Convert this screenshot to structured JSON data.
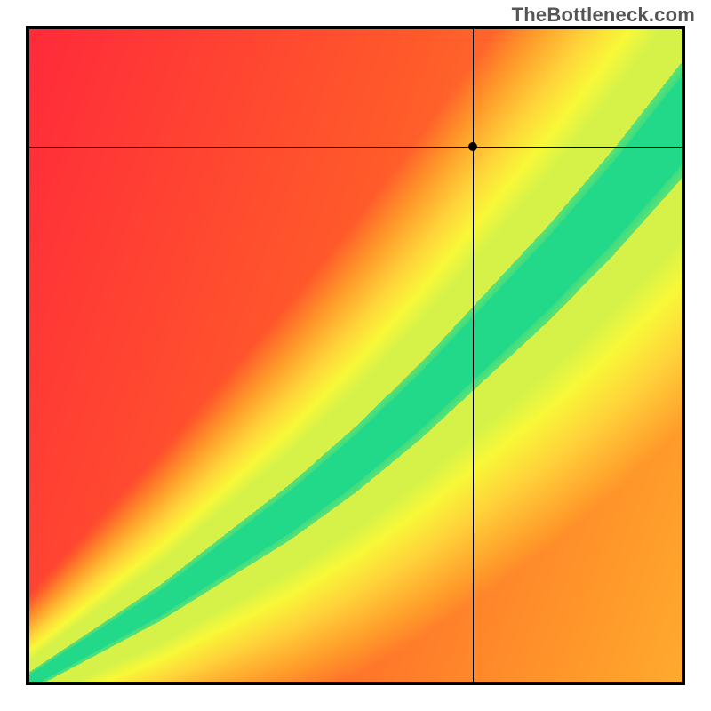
{
  "watermark": "TheBottleneck.com",
  "chart_data": {
    "type": "heatmap",
    "title": "",
    "xlabel": "",
    "ylabel": "",
    "xlim": [
      0,
      100
    ],
    "ylim": [
      0,
      100
    ],
    "crosshair": {
      "x": 68,
      "y": 82
    },
    "marker": {
      "x": 68,
      "y": 82
    },
    "optimum_ridge_description": "Diagonal green band from bottom-left to top-right indicating balanced pairing; color transitions red→orange→yellow→green→yellow as distance from ridge changes.",
    "ridge_points": [
      {
        "x": 0,
        "center": 0,
        "half_width": 1.0
      },
      {
        "x": 10,
        "center": 6,
        "half_width": 1.5
      },
      {
        "x": 20,
        "center": 12,
        "half_width": 2.0
      },
      {
        "x": 30,
        "center": 19,
        "half_width": 2.6
      },
      {
        "x": 40,
        "center": 26,
        "half_width": 3.2
      },
      {
        "x": 50,
        "center": 34,
        "half_width": 3.8
      },
      {
        "x": 60,
        "center": 43,
        "half_width": 4.4
      },
      {
        "x": 70,
        "center": 53,
        "half_width": 5.0
      },
      {
        "x": 80,
        "center": 63,
        "half_width": 5.6
      },
      {
        "x": 90,
        "center": 74,
        "half_width": 6.2
      },
      {
        "x": 100,
        "center": 86,
        "half_width": 6.8
      }
    ],
    "color_stops": [
      {
        "t": 0.0,
        "color": "#FF2A3A"
      },
      {
        "t": 0.2,
        "color": "#FF5A2A"
      },
      {
        "t": 0.4,
        "color": "#FF9A2A"
      },
      {
        "t": 0.58,
        "color": "#FFD23A"
      },
      {
        "t": 0.72,
        "color": "#F8F838"
      },
      {
        "t": 0.86,
        "color": "#C8F050"
      },
      {
        "t": 1.0,
        "color": "#22D98A"
      }
    ]
  }
}
